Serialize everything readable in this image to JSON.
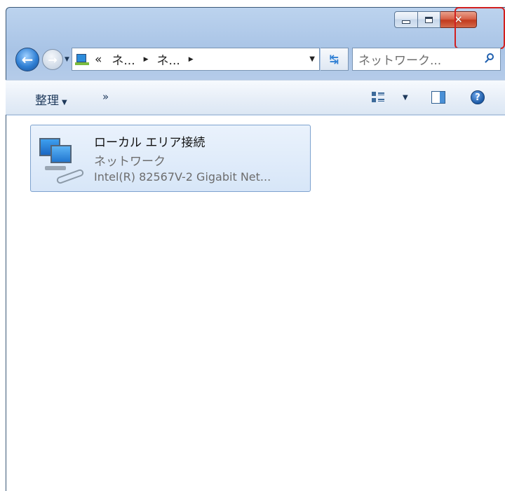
{
  "window": {
    "caption": {
      "minimize": "",
      "maximize": "",
      "close": "✕"
    }
  },
  "navigation": {
    "back_glyph": "←",
    "forward_glyph": "→",
    "dropdown_glyph": "▼"
  },
  "address_bar": {
    "overflow": "«",
    "segments": [
      "ネ...",
      "ネ..."
    ],
    "separator_glyph": "▶",
    "dropdown_glyph": "▼",
    "refresh_glyph": "↹"
  },
  "search": {
    "placeholder": "ネットワーク..."
  },
  "command_bar": {
    "organize_label": "整理",
    "organize_arrow": "▼",
    "more_label": "»",
    "views_arrow": "▼",
    "help_glyph": "?"
  },
  "items": [
    {
      "name": "ローカル エリア接続",
      "status": "ネットワーク",
      "device": "Intel(R) 82567V-2 Gigabit Net..."
    }
  ],
  "colors": {
    "close_button": "#c13a1e",
    "highlight_outline": "#d21f1f",
    "selection_border": "#7da2ce",
    "selection_fill": "#d7e6f8"
  }
}
